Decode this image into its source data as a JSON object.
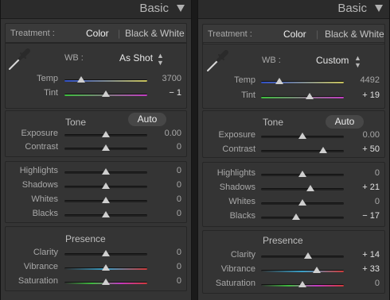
{
  "panels": {
    "left": {
      "header_title": "Basic",
      "treatment": {
        "label": "Treatment :",
        "color": "Color",
        "bw": "Black & White"
      },
      "wb": {
        "label": "WB :",
        "value": "As Shot"
      },
      "tone": {
        "title": "Tone",
        "auto": "Auto"
      },
      "presence": {
        "title": "Presence"
      },
      "sliders": [
        {
          "label": "Temp",
          "value": "3700",
          "position": 0.2,
          "track": "temp"
        },
        {
          "label": "Tint",
          "value": "− 1",
          "position": 0.5,
          "track": "tint"
        },
        {
          "label": "Exposure",
          "value": "0.00",
          "position": 0.5,
          "track": "neutral"
        },
        {
          "label": "Contrast",
          "value": "0",
          "position": 0.5,
          "track": "neutral"
        },
        {
          "label": "Highlights",
          "value": "0",
          "position": 0.5,
          "track": "neutral"
        },
        {
          "label": "Shadows",
          "value": "0",
          "position": 0.5,
          "track": "neutral"
        },
        {
          "label": "Whites",
          "value": "0",
          "position": 0.5,
          "track": "neutral"
        },
        {
          "label": "Blacks",
          "value": "0",
          "position": 0.5,
          "track": "neutral"
        },
        {
          "label": "Clarity",
          "value": "0",
          "position": 0.5,
          "track": "neutral"
        },
        {
          "label": "Vibrance",
          "value": "0",
          "position": 0.5,
          "track": "vibrance"
        },
        {
          "label": "Saturation",
          "value": "0",
          "position": 0.5,
          "track": "saturation"
        }
      ]
    },
    "right": {
      "header_title": "Basic",
      "treatment": {
        "label": "Treatment :",
        "color": "Color",
        "bw": "Black & White"
      },
      "wb": {
        "label": "WB :",
        "value": "Custom"
      },
      "tone": {
        "title": "Tone",
        "auto": "Auto"
      },
      "presence": {
        "title": "Presence"
      },
      "sliders": [
        {
          "label": "Temp",
          "value": "4492",
          "position": 0.22,
          "track": "temp"
        },
        {
          "label": "Tint",
          "value": "+ 19",
          "position": 0.59,
          "track": "tint"
        },
        {
          "label": "Exposure",
          "value": "0.00",
          "position": 0.5,
          "track": "neutral"
        },
        {
          "label": "Contrast",
          "value": "+ 50",
          "position": 0.75,
          "track": "neutral"
        },
        {
          "label": "Highlights",
          "value": "0",
          "position": 0.5,
          "track": "neutral"
        },
        {
          "label": "Shadows",
          "value": "+ 21",
          "position": 0.6,
          "track": "neutral"
        },
        {
          "label": "Whites",
          "value": "0",
          "position": 0.5,
          "track": "neutral"
        },
        {
          "label": "Blacks",
          "value": "− 17",
          "position": 0.42,
          "track": "neutral"
        },
        {
          "label": "Clarity",
          "value": "+ 14",
          "position": 0.57,
          "track": "neutral"
        },
        {
          "label": "Vibrance",
          "value": "+ 33",
          "position": 0.67,
          "track": "vibrance"
        },
        {
          "label": "Saturation",
          "value": "0",
          "position": 0.5,
          "track": "saturation"
        }
      ]
    }
  },
  "track_colors": {
    "temp": [
      "#2f4fc8",
      "#c9c35a"
    ],
    "tint": [
      "#3dbf3d",
      "#c23cc2"
    ],
    "neutral": [
      "#202020",
      "#202020"
    ],
    "vibrance": [
      "#2f2f2f",
      "#3aa0c8",
      "#cf3a3a"
    ],
    "saturation": [
      "#2f2f2f",
      "#3fb93f",
      "#c03ac0",
      "#cf3a3a"
    ]
  },
  "icons": {
    "collapse": "triangle-down",
    "eyedropper": "eyedropper",
    "stepper": "up-down-arrows"
  },
  "colors": {
    "panel_bg": "#343434",
    "header_bg": "#2b2b2b",
    "thumb": "#cfcfcf"
  }
}
